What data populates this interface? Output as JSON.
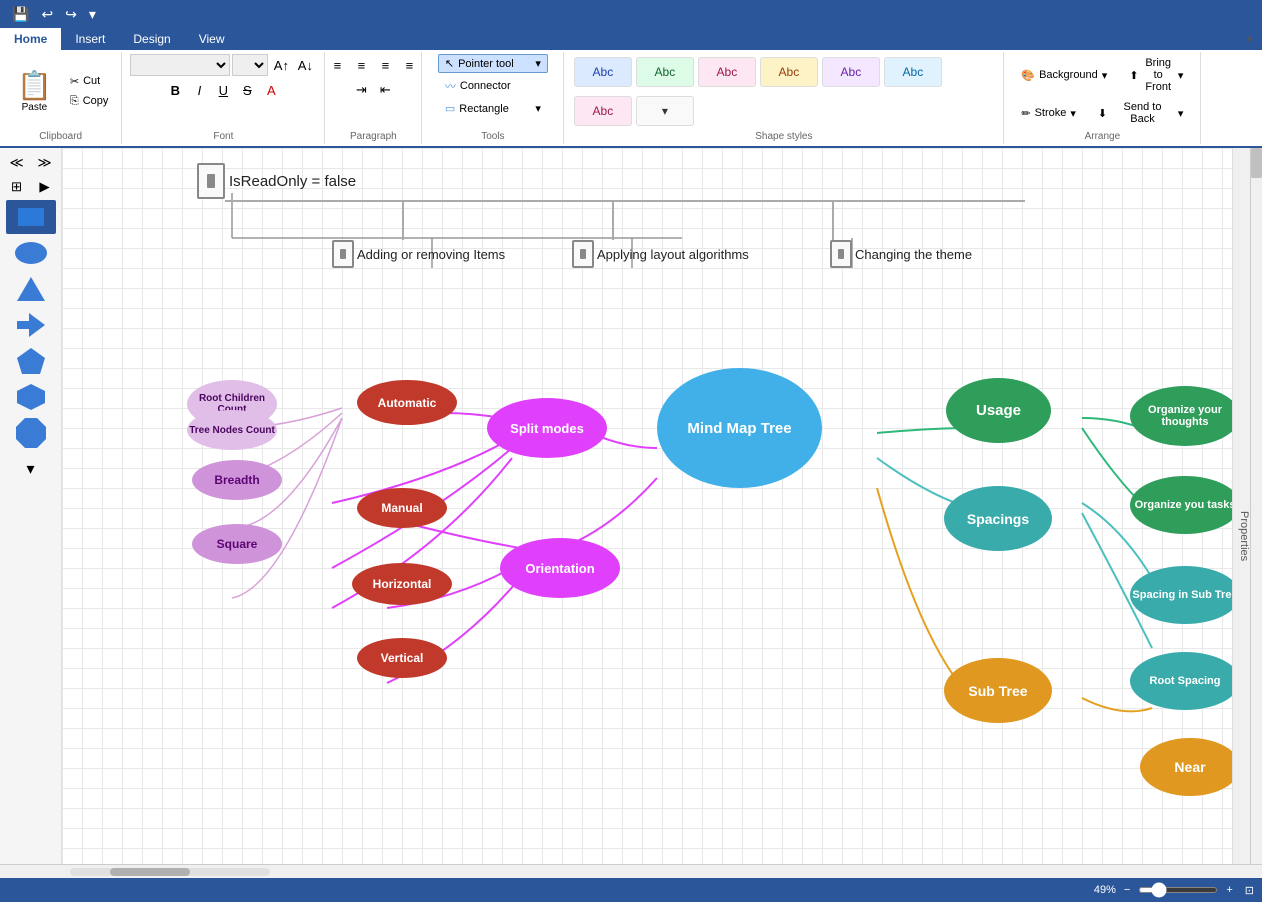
{
  "quickAccess": {
    "saveIcon": "💾",
    "undoIcon": "↩",
    "redoIcon": "↪",
    "dropdownIcon": "▼"
  },
  "ribbonTabs": [
    "Home",
    "Insert",
    "Design",
    "View"
  ],
  "activeTab": "Home",
  "clipboard": {
    "pasteLabel": "Paste",
    "cutLabel": "Cut",
    "copyLabel": "Copy"
  },
  "font": {
    "family": "",
    "size": "",
    "boldLabel": "B",
    "italicLabel": "I",
    "underlineLabel": "U",
    "strikeLabel": "S"
  },
  "paragraph": {
    "alignLeft": "≡",
    "alignCenter": "≡",
    "alignRight": "≡",
    "indent": "→",
    "outdent": "←"
  },
  "tools": {
    "pointerLabel": "Pointer tool",
    "connectorLabel": "Connector",
    "rectangleLabel": "Rectangle"
  },
  "shapeStyles": {
    "label": "Shape styles",
    "styles": [
      {
        "label": "Abc",
        "bg": "#dbeafe",
        "color": "#1e40af"
      },
      {
        "label": "Abc",
        "bg": "#dcfce7",
        "color": "#166534"
      },
      {
        "label": "Abc",
        "bg": "#fce7f3",
        "color": "#9d174d"
      },
      {
        "label": "Abc",
        "bg": "#fef3c7",
        "color": "#92400e"
      },
      {
        "label": "Abc",
        "bg": "#f3e8ff",
        "color": "#6b21a8"
      },
      {
        "label": "Abc",
        "bg": "#e0f2fe",
        "color": "#0369a1"
      },
      {
        "label": "Abc",
        "bg": "#fce7f3",
        "color": "#9d174d"
      }
    ]
  },
  "arrange": {
    "backgroundLabel": "Background",
    "strokeLabel": "Stroke",
    "bringFrontLabel": "Bring to Front",
    "sendBackLabel": "Send to Back"
  },
  "leftTools": {
    "shapes": [
      "▭",
      "⬭",
      "▲",
      "◀",
      "⬠",
      "⬡",
      "⬡"
    ]
  },
  "diagram": {
    "headerNode": "IsReadOnly = false",
    "child1": "Adding or removing Items",
    "child2": "Applying layout algorithms",
    "child3": "Changing the theme",
    "centerNode": "Mind Map Tree",
    "splitModesNode": "Split modes",
    "orientationNode": "Orientation",
    "automaticNode": "Automatic",
    "manualNode": "Manual",
    "horizontalNode": "Horizontal",
    "verticalNode": "Vertical",
    "breadthNode": "Breadth",
    "squareNode": "Square",
    "rootChildrenCountNode": "Root Children Count",
    "treeNodesCountNode": "Tree Nodes Count",
    "usageNode": "Usage",
    "spacingsNode": "Spacings",
    "subTreeNode": "Sub Tree",
    "organizeThoughtsNode": "Organize your thoughts",
    "organizeTasksNode": "Organize you tasks",
    "spacingSubTreeNode": "Spacing in Sub Tree",
    "rootSpacingNode": "Root Spacing",
    "nearNode": "Near"
  },
  "statusBar": {
    "zoomLevel": "49%"
  },
  "propertiesLabel": "Properties"
}
